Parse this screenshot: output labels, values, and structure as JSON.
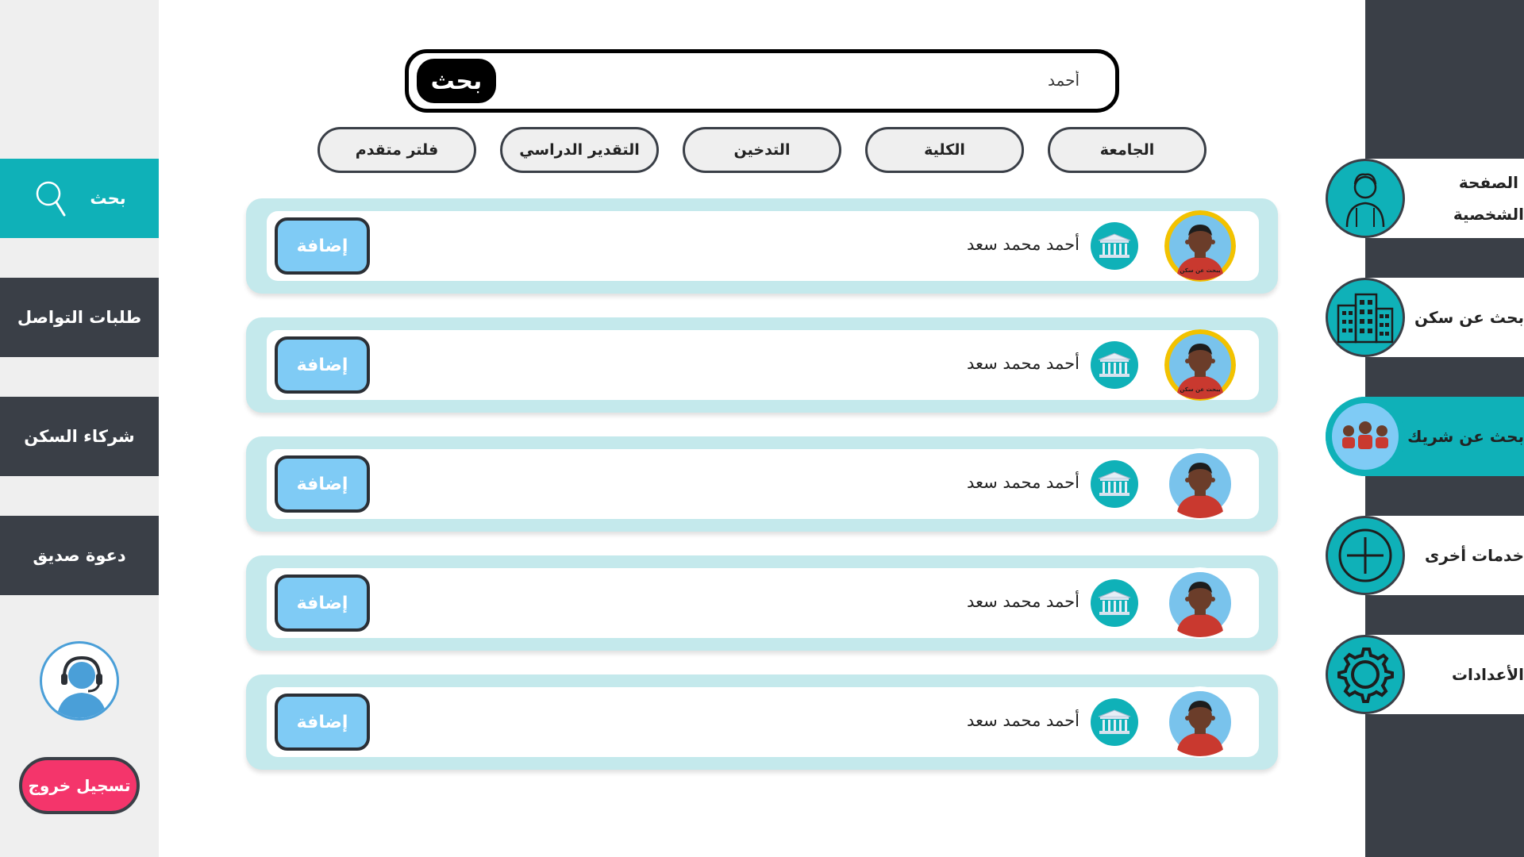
{
  "search": {
    "button_label": "بحث",
    "value": "أحمد"
  },
  "filters": [
    "الجامعة",
    "الكلية",
    "التدخين",
    "التقدير الدراسي",
    "فلتر متقدم"
  ],
  "left_nav": {
    "search": "بحث",
    "contact_requests": "طلبات التواصل",
    "housing_partners": "شركاء السكن",
    "invite_friend": "دعوة صديق",
    "logout": "تسجيل خروج"
  },
  "right_nav": {
    "profile_line1": "الصفحة",
    "profile_line2": "الشخصية",
    "find_housing": "بحث عن سكن",
    "find_partner": "بحث عن شريك",
    "other_services": "خدمات أخرى",
    "settings": "الأعدادات"
  },
  "results": [
    {
      "name": "أحمد محمد سعد",
      "add_label": "إضافة",
      "badge": "يبحث عن سكن",
      "has_badge": true
    },
    {
      "name": "أحمد محمد سعد",
      "add_label": "إضافة",
      "badge": "يبحث عن سكن",
      "has_badge": true
    },
    {
      "name": "أحمد محمد سعد",
      "add_label": "إضافة",
      "badge": "",
      "has_badge": false
    },
    {
      "name": "أحمد محمد سعد",
      "add_label": "إضافة",
      "badge": "",
      "has_badge": false
    },
    {
      "name": "أحمد محمد سعد",
      "add_label": "إضافة",
      "badge": "",
      "has_badge": false
    }
  ],
  "colors": {
    "accent": "#0fb1b8",
    "dark": "#3a3f47",
    "card": "#c4e9ec",
    "add_button": "#7fcbf5",
    "logout": "#f4356b",
    "badge_ring": "#f2c200"
  }
}
